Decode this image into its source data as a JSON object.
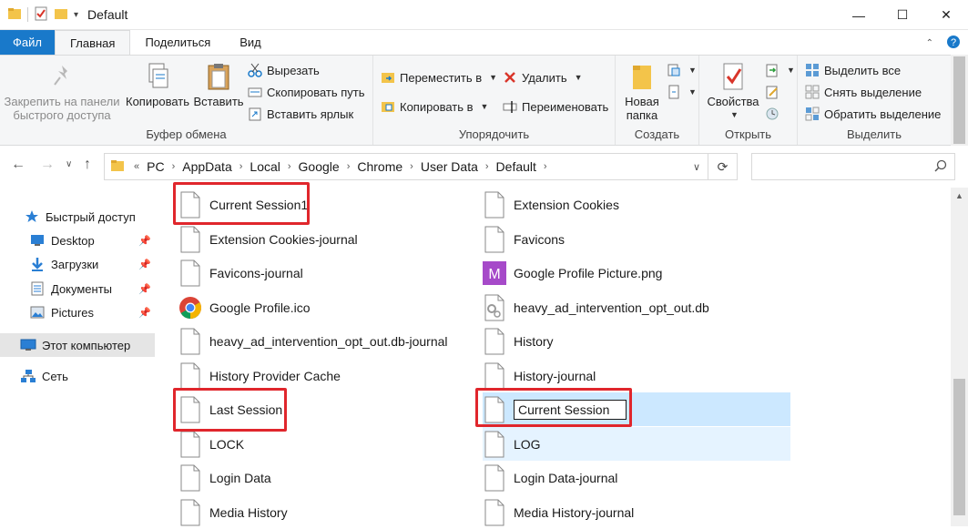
{
  "window": {
    "title": "Default",
    "controls": {
      "minimize": "—",
      "maximize": "☐",
      "close": "✕"
    }
  },
  "ribbon_tabs": [
    {
      "label": "Файл"
    },
    {
      "label": "Главная"
    },
    {
      "label": "Поделиться"
    },
    {
      "label": "Вид"
    }
  ],
  "ribbon": {
    "clipboard": {
      "pin_label_1": "Закрепить на панели",
      "pin_label_2": "быстрого доступа",
      "copy": "Копировать",
      "paste": "Вставить",
      "cut": "Вырезать",
      "copy_path": "Скопировать путь",
      "paste_shortcut": "Вставить ярлык",
      "group_label": "Буфер обмена"
    },
    "organize": {
      "move_to": "Переместить в",
      "copy_to": "Копировать в",
      "delete": "Удалить",
      "rename": "Переименовать",
      "group_label": "Упорядочить"
    },
    "new": {
      "new_folder_1": "Новая",
      "new_folder_2": "папка",
      "group_label": "Создать"
    },
    "open": {
      "properties": "Свойства",
      "group_label": "Открыть"
    },
    "select": {
      "select_all": "Выделить все",
      "select_none": "Снять выделение",
      "invert": "Обратить выделение",
      "group_label": "Выделить"
    }
  },
  "address": {
    "prefix": "«",
    "crumbs": [
      "PC",
      "AppData",
      "Local",
      "Google",
      "Chrome",
      "User Data",
      "Default"
    ],
    "search_placeholder": ""
  },
  "nav": [
    {
      "label": "Быстрый доступ",
      "icon": "star-icon"
    },
    {
      "label": "Desktop",
      "icon": "desktop-icon",
      "pinned": true
    },
    {
      "label": "Загрузки",
      "icon": "download-icon",
      "pinned": true
    },
    {
      "label": "Документы",
      "icon": "documents-icon",
      "pinned": true
    },
    {
      "label": "Pictures",
      "icon": "pictures-icon",
      "pinned": true
    },
    {
      "label": "Этот компьютер",
      "icon": "computer-icon",
      "selected": true
    },
    {
      "label": "Сеть",
      "icon": "network-icon"
    }
  ],
  "files_left": [
    {
      "name": "Current Session1",
      "icon": "file-icon",
      "highlighted": true
    },
    {
      "name": "Extension Cookies-journal",
      "icon": "file-icon"
    },
    {
      "name": "Favicons-journal",
      "icon": "file-icon"
    },
    {
      "name": "Google Profile.ico",
      "icon": "chrome-icon"
    },
    {
      "name": "heavy_ad_intervention_opt_out.db-journal",
      "icon": "file-icon"
    },
    {
      "name": "History Provider Cache",
      "icon": "file-icon"
    },
    {
      "name": "Last Session",
      "icon": "file-icon",
      "highlighted": true
    },
    {
      "name": "LOCK",
      "icon": "file-icon"
    },
    {
      "name": "Login Data",
      "icon": "file-icon"
    },
    {
      "name": "Media History",
      "icon": "file-icon"
    }
  ],
  "files_right": [
    {
      "name": "Extension Cookies",
      "icon": "file-icon"
    },
    {
      "name": "Favicons",
      "icon": "file-icon"
    },
    {
      "name": "Google Profile Picture.png",
      "icon": "image-m-icon"
    },
    {
      "name": "heavy_ad_intervention_opt_out.db",
      "icon": "db-file-icon"
    },
    {
      "name": "History",
      "icon": "file-icon"
    },
    {
      "name": "History-journal",
      "icon": "file-icon"
    },
    {
      "name": "Current Session",
      "icon": "file-icon",
      "renaming": true,
      "highlighted": true
    },
    {
      "name": "LOG",
      "icon": "file-icon"
    },
    {
      "name": "Login Data-journal",
      "icon": "file-icon"
    },
    {
      "name": "Media History-journal",
      "icon": "file-icon"
    }
  ],
  "colors": {
    "accent": "#1979ca",
    "selection": "#cce8ff",
    "highlight_box": "#e0262c"
  }
}
